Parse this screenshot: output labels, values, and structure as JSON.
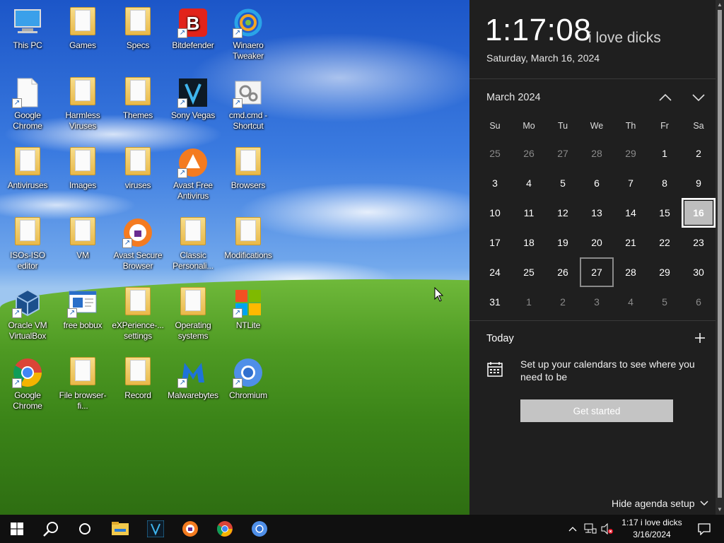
{
  "desktop": {
    "icons": [
      {
        "label": "This PC",
        "icon": "computer-icon"
      },
      {
        "label": "Games",
        "icon": "folder-icon"
      },
      {
        "label": "Specs",
        "icon": "folder-icon"
      },
      {
        "label": "Bitdefender",
        "icon": "bitdefender-icon"
      },
      {
        "label": "Winaero Tweaker",
        "icon": "winaero-icon"
      },
      {
        "label": "Google Chrome",
        "icon": "blank-file-icon"
      },
      {
        "label": "Harmless Viruses",
        "icon": "folder-icon"
      },
      {
        "label": "Themes",
        "icon": "folder-icon"
      },
      {
        "label": "Sony Vegas",
        "icon": "vegas-icon"
      },
      {
        "label": "cmd.cmd - Shortcut",
        "icon": "gears-icon"
      },
      {
        "label": "Antiviruses",
        "icon": "folder-icon"
      },
      {
        "label": "Images",
        "icon": "folder-icon"
      },
      {
        "label": "viruses",
        "icon": "folder-icon"
      },
      {
        "label": "Avast Free Antivirus",
        "icon": "avast-icon"
      },
      {
        "label": "Browsers",
        "icon": "folder-icon"
      },
      {
        "label": "ISOs-ISO editor",
        "icon": "folder-icon"
      },
      {
        "label": "VM",
        "icon": "folder-icon"
      },
      {
        "label": "Avast Secure Browser",
        "icon": "avast-browser-icon"
      },
      {
        "label": "Classic Personali...",
        "icon": "folder-icon"
      },
      {
        "label": "Modifications",
        "icon": "folder-icon"
      },
      {
        "label": "Oracle VM VirtualBox",
        "icon": "virtualbox-icon"
      },
      {
        "label": "free bobux",
        "icon": "window-icon"
      },
      {
        "label": "eXPerience-... settings",
        "icon": "folder-icon"
      },
      {
        "label": "Operating systems",
        "icon": "folder-icon"
      },
      {
        "label": "NTLite",
        "icon": "ntlite-icon"
      },
      {
        "label": "Google Chrome",
        "icon": "chrome-icon"
      },
      {
        "label": "File browser-fi...",
        "icon": "folder-icon"
      },
      {
        "label": "Record",
        "icon": "folder-icon"
      },
      {
        "label": "Malwarebytes",
        "icon": "malwarebytes-icon"
      },
      {
        "label": "Chromium",
        "icon": "chromium-icon"
      }
    ]
  },
  "flyout": {
    "time": "1:17:08",
    "suffix": "i love dicks",
    "date": "Saturday, March 16, 2024",
    "month_label": "March 2024",
    "weekdays": [
      "Su",
      "Mo",
      "Tu",
      "We",
      "Th",
      "Fr",
      "Sa"
    ],
    "weeks": [
      [
        "25",
        "26",
        "27",
        "28",
        "29",
        "1",
        "2"
      ],
      [
        "3",
        "4",
        "5",
        "6",
        "7",
        "8",
        "9"
      ],
      [
        "10",
        "11",
        "12",
        "13",
        "14",
        "15",
        "16"
      ],
      [
        "17",
        "18",
        "19",
        "20",
        "21",
        "22",
        "23"
      ],
      [
        "24",
        "25",
        "26",
        "27",
        "28",
        "29",
        "30"
      ],
      [
        "31",
        "1",
        "2",
        "3",
        "4",
        "5",
        "6"
      ]
    ],
    "today_label": "Today",
    "setup_message": "Set up your calendars to see where you need to be",
    "get_started": "Get started",
    "hide_agenda": "Hide agenda setup"
  },
  "taskbar": {
    "clock_time": "1:17 i love dicks",
    "clock_date": "3/16/2024"
  },
  "colors": {
    "panel_bg": "#1f1f1f",
    "taskbar_bg": "#101010",
    "windows_blue": "#0078d7"
  }
}
